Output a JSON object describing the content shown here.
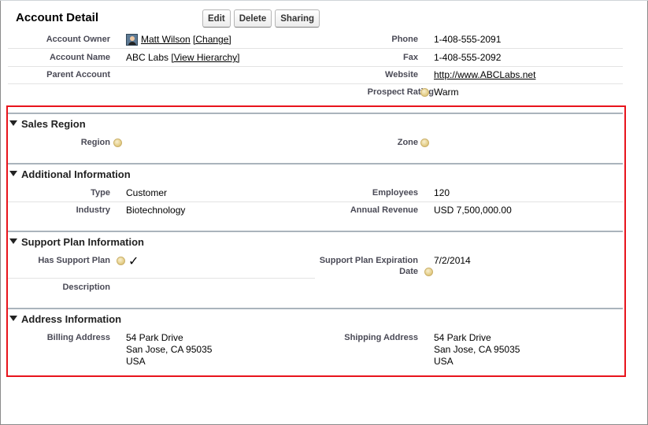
{
  "detail": {
    "title": "Account Detail",
    "buttons": {
      "edit": "Edit",
      "delete": "Delete",
      "sharing": "Sharing"
    }
  },
  "fields": {
    "owner_label": "Account Owner",
    "owner_name": "Matt Wilson",
    "owner_change": "[Change]",
    "name_label": "Account Name",
    "name_value": "ABC Labs",
    "name_hierarchy": "[View Hierarchy]",
    "parent_label": "Parent Account",
    "phone_label": "Phone",
    "phone_value": "1-408-555-2091",
    "fax_label": "Fax",
    "fax_value": "1-408-555-2092",
    "website_label": "Website",
    "website_value": "http://www.ABCLabs.net",
    "rating_label": "Prospect Rating",
    "rating_value": "Warm"
  },
  "sections": {
    "sales_region": {
      "title": "Sales Region",
      "region_label": "Region",
      "zone_label": "Zone"
    },
    "additional": {
      "title": "Additional Information",
      "type_label": "Type",
      "type_value": "Customer",
      "industry_label": "Industry",
      "industry_value": "Biotechnology",
      "employees_label": "Employees",
      "employees_value": "120",
      "revenue_label": "Annual Revenue",
      "revenue_value": "USD 7,500,000.00"
    },
    "support": {
      "title": "Support Plan Information",
      "has_plan_label": "Has Support Plan",
      "has_plan_value": "✓",
      "expiration_label_1": "Support Plan Expiration",
      "expiration_label_2": "Date",
      "expiration_value": "7/2/2014",
      "description_label": "Description"
    },
    "address": {
      "title": "Address Information",
      "billing_label": "Billing Address",
      "billing_line1": "54 Park Drive",
      "billing_line2": "San Jose, CA 95035",
      "billing_line3": "USA",
      "shipping_label": "Shipping Address",
      "shipping_line1": "54 Park Drive",
      "shipping_line2": "San Jose, CA 95035",
      "shipping_line3": "USA"
    }
  },
  "colors": {
    "highlight_border": "#e8141c",
    "section_rule": "#aab4bc",
    "label_text": "#4a4a56"
  }
}
